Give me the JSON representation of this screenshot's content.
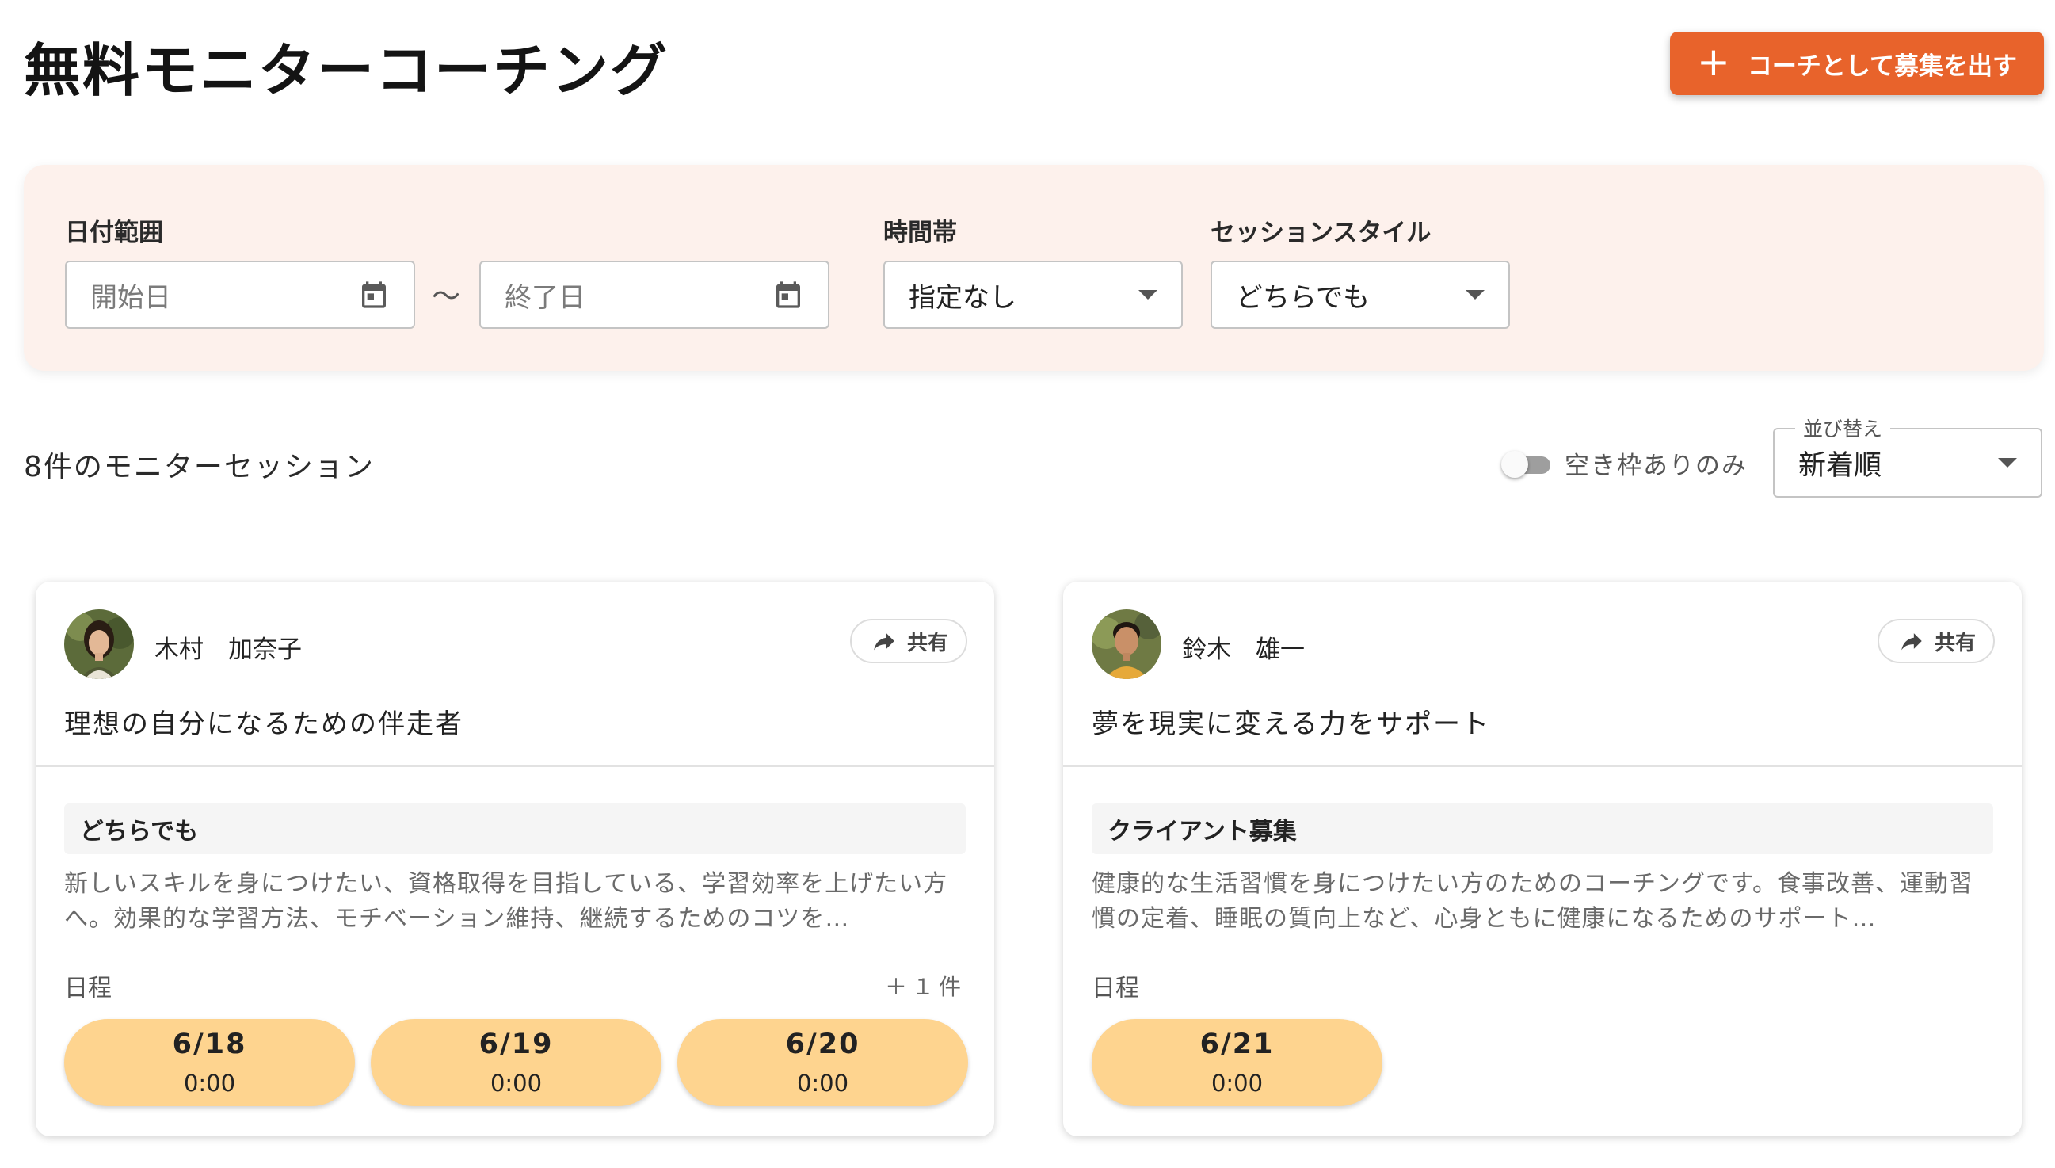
{
  "header": {
    "title": "無料モニターコーチング",
    "recruit_button_label": "コーチとして募集を出す"
  },
  "filters": {
    "date_range_label": "日付範囲",
    "start_date_placeholder": "開始日",
    "end_date_placeholder": "終了日",
    "range_separator": "〜",
    "time_slot_label": "時間帯",
    "time_slot_value": "指定なし",
    "session_style_label": "セッションスタイル",
    "session_style_value": "どちらでも"
  },
  "results": {
    "count_text": "8件のモニターセッション",
    "available_only_label": "空き枠ありのみ",
    "available_only_checked": false,
    "sort_label": "並び替え",
    "sort_value": "新着順"
  },
  "cards": [
    {
      "coach_name": "木村　加奈子",
      "share_label": "共有",
      "catch_copy": "理想の自分になるための伴走者",
      "style": "どちらでも",
      "description": "新しいスキルを身につけたい、資格取得を目指している、学習効率を上げたい方へ。効果的な学習方法、モチベーション維持、継続するためのコツを…",
      "schedule_label": "日程",
      "more_count": "＋１件",
      "slots": [
        {
          "date": "6/18",
          "time": "0:00"
        },
        {
          "date": "6/19",
          "time": "0:00"
        },
        {
          "date": "6/20",
          "time": "0:00"
        }
      ]
    },
    {
      "coach_name": "鈴木　雄一",
      "share_label": "共有",
      "catch_copy": "夢を現実に変える力をサポート",
      "style": "クライアント募集",
      "description": "健康的な生活習慣を身につけたい方のためのコーチングです。食事改善、運動習慣の定着、睡眠の質向上など、心身ともに健康になるためのサポート…",
      "schedule_label": "日程",
      "slots": [
        {
          "date": "6/21",
          "time": "0:00"
        }
      ]
    }
  ],
  "colors": {
    "accent": "#e8632b",
    "filter_panel_bg": "#fdf1ec",
    "slot_bg": "#fed48f"
  }
}
